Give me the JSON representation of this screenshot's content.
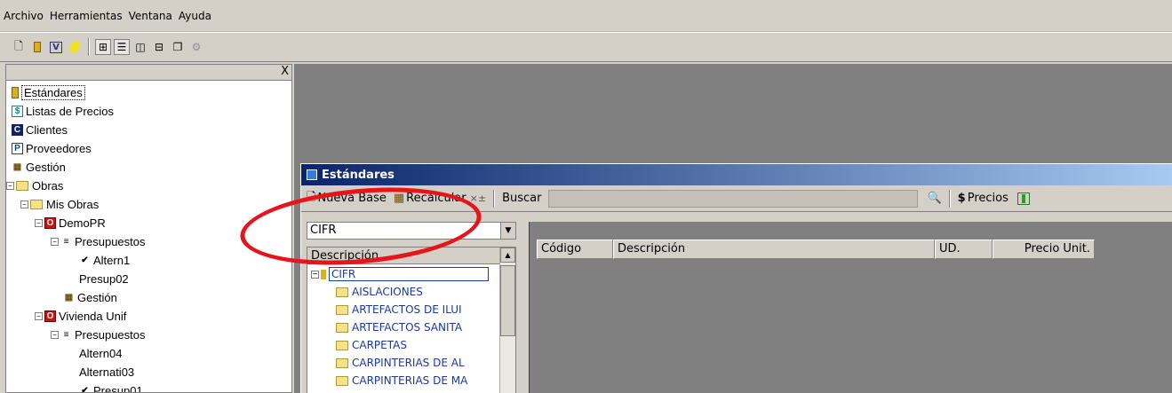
{
  "menu": [
    "Archivo",
    "Herramientas",
    "Ventana",
    "Ayuda"
  ],
  "toolbar_icons": [
    "new-doc-icon",
    "database-icon",
    "v-icon",
    "lightbulb-icon",
    "tree-view-icon",
    "list-view-icon",
    "split-vertical-icon",
    "split-horizontal-icon",
    "windows-icon",
    "gear-icon"
  ],
  "left_panel": {
    "close": "X",
    "tree": [
      {
        "label": "Estándares",
        "icon": "database-icon"
      },
      {
        "label": "Listas de Precios",
        "icon": "dollar-icon"
      },
      {
        "label": "Clientes",
        "icon": "c-icon"
      },
      {
        "label": "Proveedores",
        "icon": "p-icon"
      },
      {
        "label": "Gestión",
        "icon": "building-icon"
      },
      {
        "label": "Obras",
        "icon": "folder-icon"
      },
      {
        "label": "Mis Obras",
        "icon": "folder-icon"
      },
      {
        "label": "DemoPR",
        "icon": "o-icon"
      },
      {
        "label": "Presupuestos",
        "icon": "list-icon"
      },
      {
        "label": "Altern1",
        "icon": "check-icon"
      },
      {
        "label": "Presup02",
        "icon": ""
      },
      {
        "label": "Gestión",
        "icon": "building-icon"
      },
      {
        "label": "Vivienda Unif",
        "icon": "o-icon"
      },
      {
        "label": "Presupuestos",
        "icon": "list-icon"
      },
      {
        "label": "Altern04",
        "icon": ""
      },
      {
        "label": "Alternati03",
        "icon": ""
      },
      {
        "label": "Presup01",
        "icon": "check-icon"
      }
    ]
  },
  "window": {
    "title": "Estándares",
    "tools": {
      "new_base": "Nueva Base",
      "recalcular": "Recalcular",
      "buscar": "Buscar",
      "precios": "Precios"
    },
    "combo_value": "CIFR",
    "desc_header": "Descripción",
    "desc_items": [
      "CIFR",
      "AISLACIONES",
      "ARTEFACTOS DE ILUI",
      "ARTEFACTOS SANITA",
      "CARPETAS",
      "CARPINTERIAS DE AL",
      "CARPINTERIAS DE MA"
    ],
    "grid_columns": [
      "Código",
      "Descripción",
      "UD.",
      "Precio Unit."
    ]
  },
  "colors": {
    "annotation": "#e8141c",
    "workspace": "#808080",
    "title_bar": "#0a246a"
  }
}
